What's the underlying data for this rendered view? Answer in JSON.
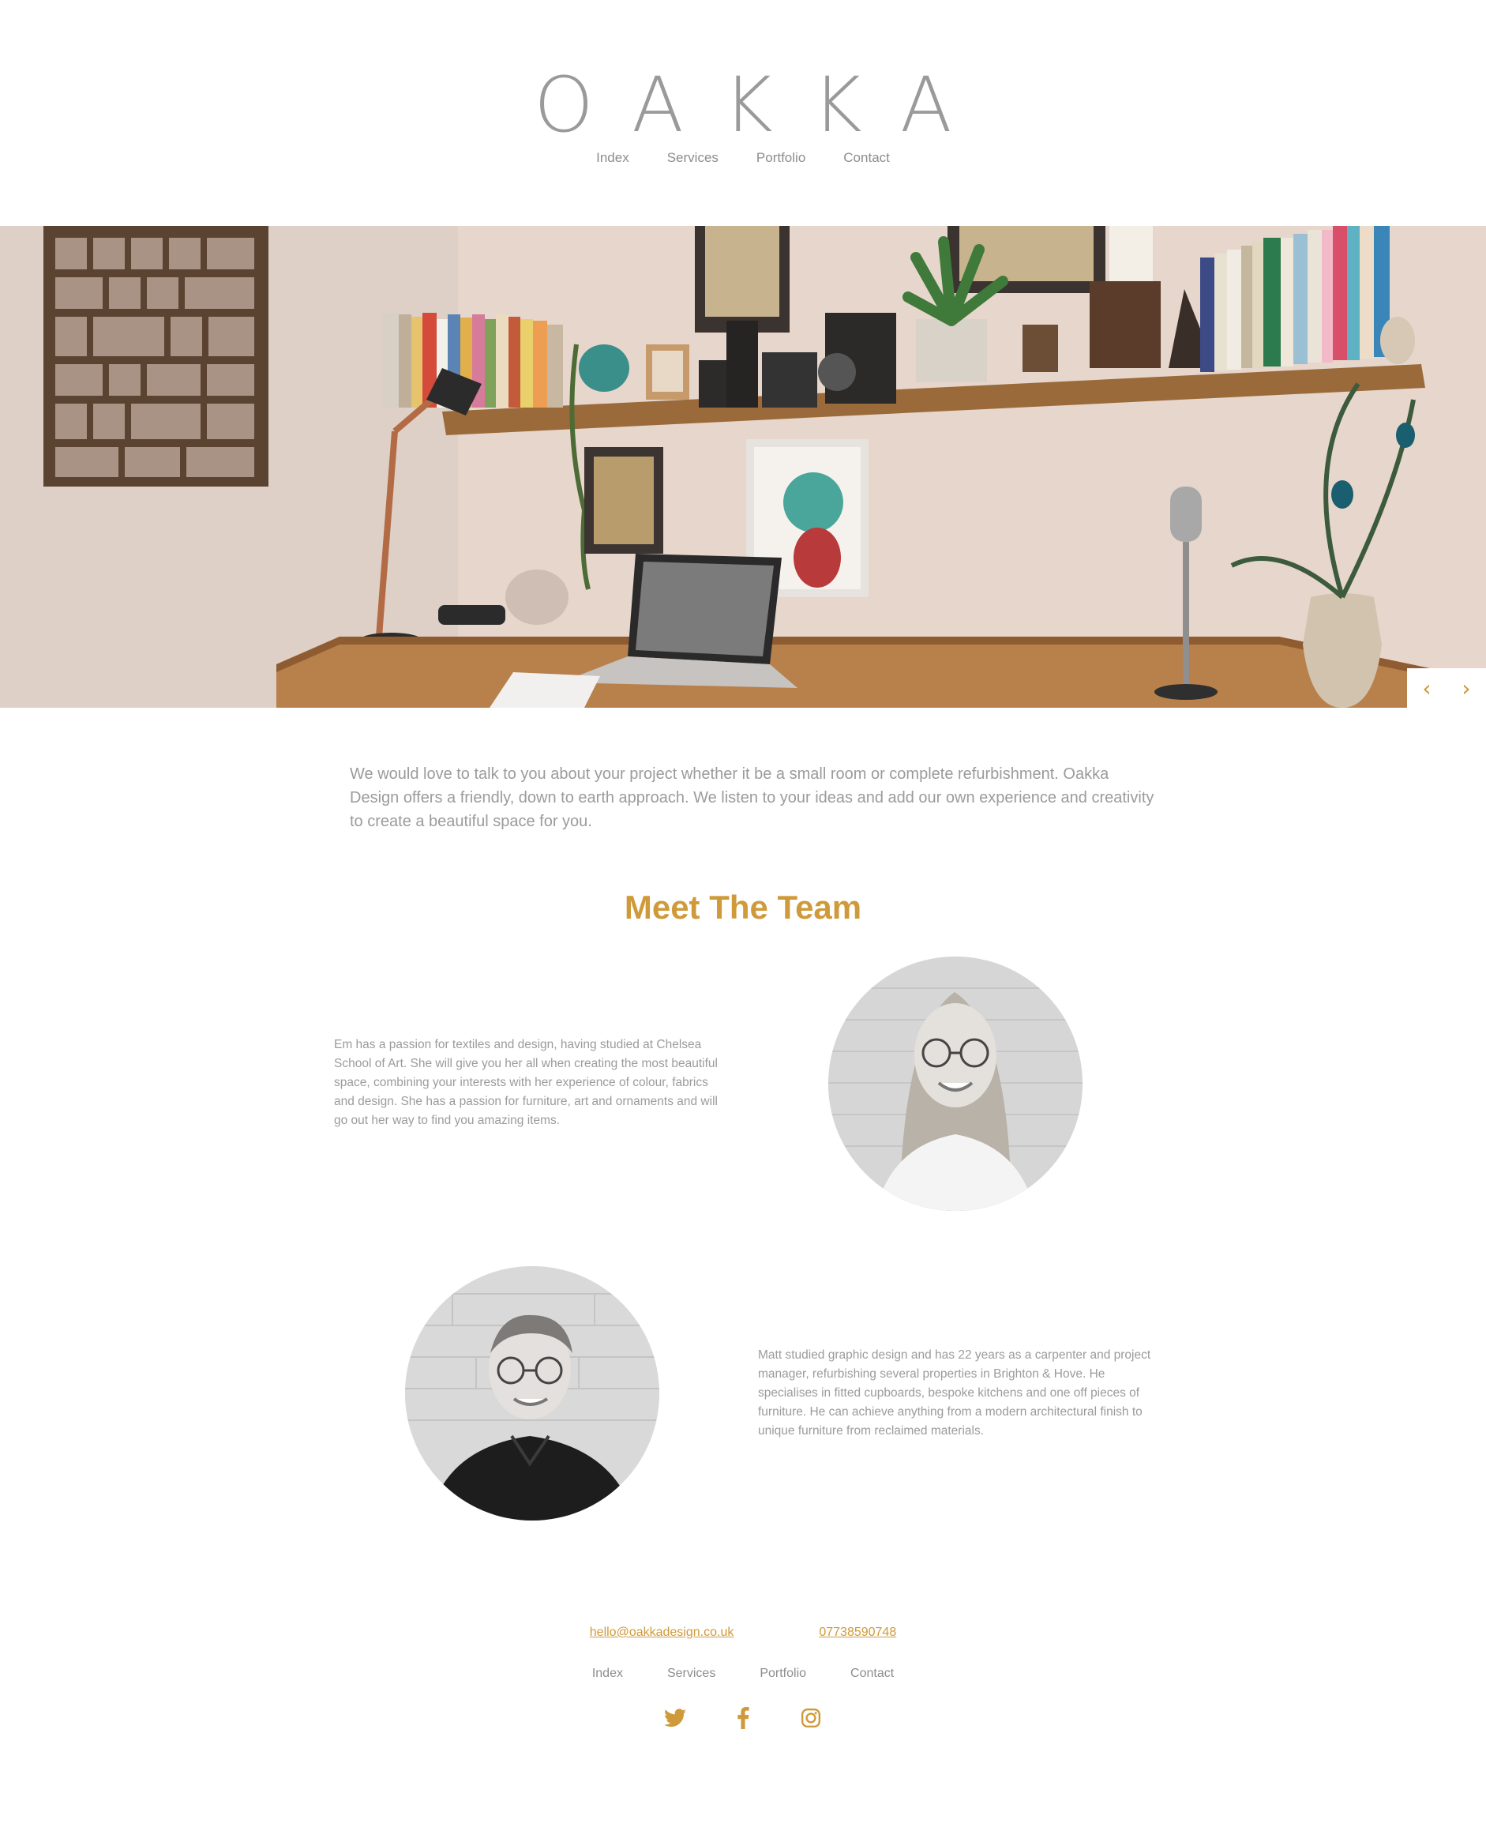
{
  "header": {
    "logo": "OAKKA",
    "nav": [
      "Index",
      "Services",
      "Portfolio",
      "Contact"
    ]
  },
  "hero": {
    "prev_icon": "chevron-left-icon",
    "next_icon": "chevron-right-icon",
    "prev_glyph": "‹",
    "next_glyph": "›"
  },
  "intro": "We would love to talk to you about your project whether it be a small room or complete refurbishment. Oakka Design offers a friendly, down to earth approach. We listen to your ideas and add our own experience and creativity to create a beautiful space for you.",
  "team": {
    "title": "Meet The Team",
    "members": [
      {
        "bio": "Em has a passion for textiles and design, having studied at Chelsea School of Art. She will give you her all when creating the most beautiful space, combining your interests with her experience of colour, fabrics and design. She has a passion for furniture, art and ornaments and will go out her way to find you amazing items."
      },
      {
        "bio": "Matt studied graphic design and has 22 years as a carpenter and project manager, refurbishing several properties in Brighton & Hove. He specialises in fitted cupboards, bespoke kitchens and one off pieces of furniture. He can achieve anything from a modern architectural finish to unique furniture from reclaimed materials."
      }
    ]
  },
  "footer": {
    "email": "hello@oakkadesign.co.uk",
    "phone": "07738590748",
    "nav": [
      "Index",
      "Services",
      "Portfolio",
      "Contact"
    ],
    "social": [
      "twitter-icon",
      "facebook-icon",
      "instagram-icon"
    ]
  },
  "colors": {
    "accent": "#cf9a3a",
    "text": "#9b9b9b"
  }
}
